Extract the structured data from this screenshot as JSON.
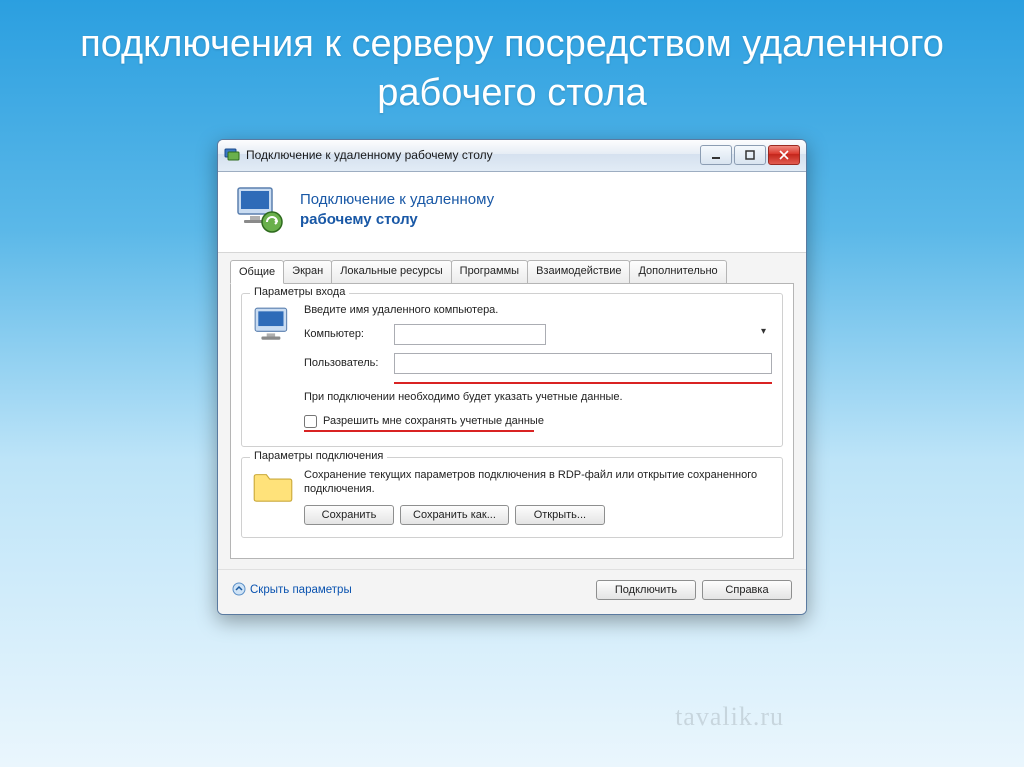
{
  "slide": {
    "title": "подключения к серверу посредством удаленного рабочего стола"
  },
  "watermark": "tavalik.ru",
  "window": {
    "title": "Подключение к удаленному рабочему столу",
    "header_line1": "Подключение к удаленному",
    "header_line2": "рабочему столу",
    "tabs": [
      "Общие",
      "Экран",
      "Локальные ресурсы",
      "Программы",
      "Взаимодействие",
      "Дополнительно"
    ],
    "group_login": {
      "title": "Параметры входа",
      "instruction": "Введите имя удаленного компьютера.",
      "computer_label": "Компьютер:",
      "computer_value": "",
      "user_label": "Пользователь:",
      "user_value": "",
      "hint": "При подключении необходимо будет указать учетные данные.",
      "checkbox_label": "Разрешить мне сохранять учетные данные"
    },
    "group_conn": {
      "title": "Параметры подключения",
      "desc": "Сохранение текущих параметров подключения в RDP-файл или открытие сохраненного подключения.",
      "save_btn": "Сохранить",
      "save_as_btn": "Сохранить как...",
      "open_btn": "Открыть..."
    },
    "footer": {
      "hide_params": "Скрыть параметры",
      "connect_btn": "Подключить",
      "help_btn": "Справка"
    }
  }
}
